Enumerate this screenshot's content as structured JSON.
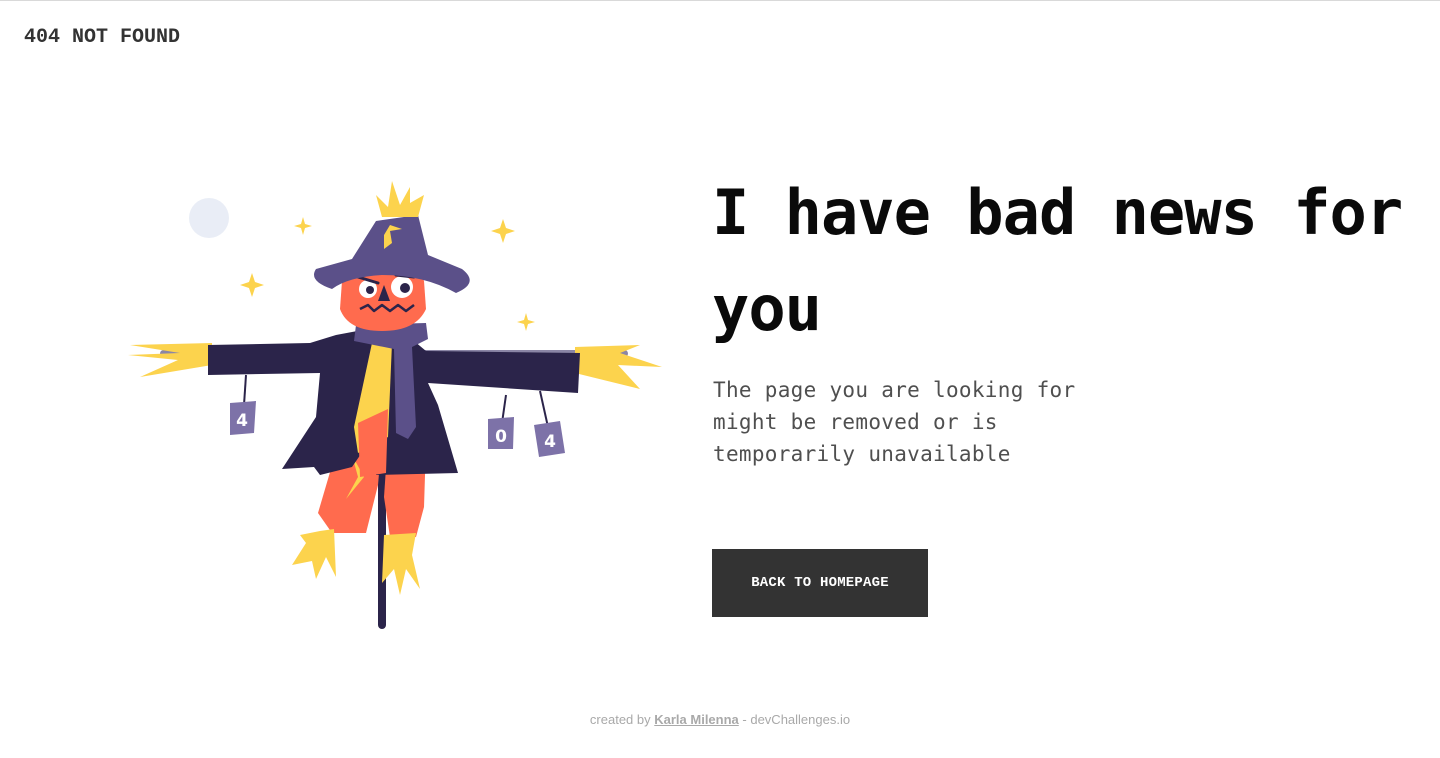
{
  "header": {
    "logo_text": "404 NOT FOUND"
  },
  "main": {
    "headline": "I have bad news for you",
    "description": "The page you are looking for might be removed or is temporarily unavailable",
    "cta_label": "BACK TO HOMEPAGE"
  },
  "illustration": {
    "can_labels": [
      "4",
      "0",
      "4"
    ]
  },
  "footer": {
    "prefix": "created by",
    "author": "Karla Milenna",
    "separator": " - ",
    "site": "devChallenges.io"
  },
  "colors": {
    "button_bg": "#333333",
    "button_text": "#ffffff",
    "headline": "#0a0a0a",
    "body_text": "#4f4f4f",
    "footer_text": "#a9a9a9",
    "coat": "#2b244a",
    "hat": "#5b5089",
    "pumpkin": "#ff6b4e",
    "straw": "#fcd34d",
    "can": "#7d72a8"
  }
}
